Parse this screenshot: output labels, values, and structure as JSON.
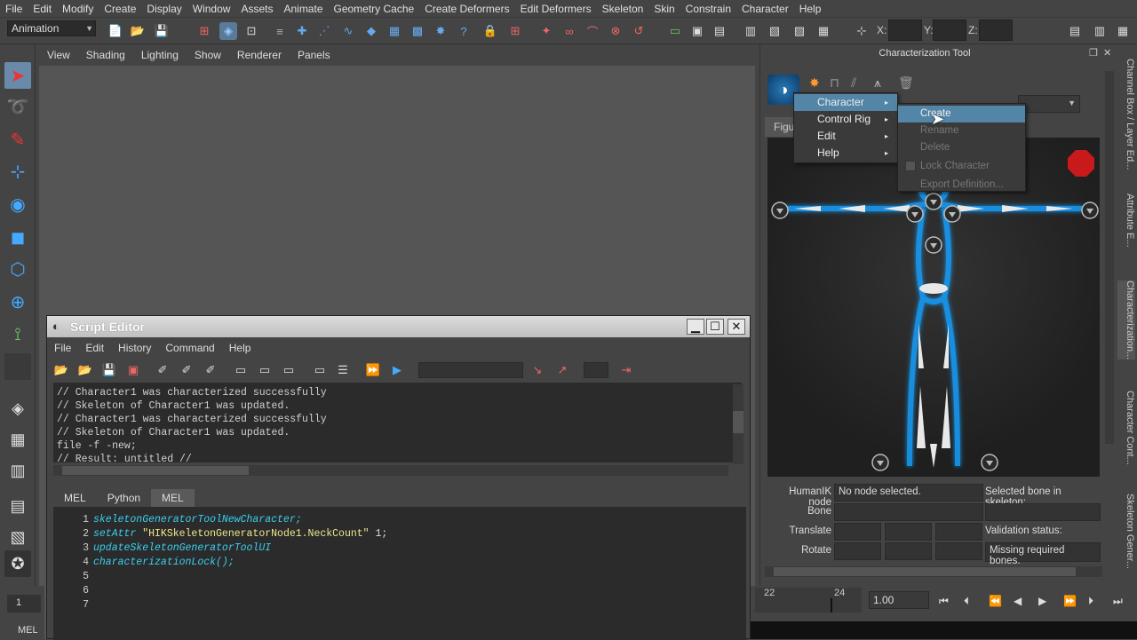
{
  "menubar": [
    "File",
    "Edit",
    "Modify",
    "Create",
    "Display",
    "Window",
    "Assets",
    "Animate",
    "Geometry Cache",
    "Create Deformers",
    "Edit Deformers",
    "Skeleton",
    "Skin",
    "Constrain",
    "Character",
    "Help"
  ],
  "status": {
    "mode": "Animation",
    "x_label": "X:",
    "y_label": "Y:",
    "z_label": "Z:"
  },
  "viewport": {
    "menu": [
      "View",
      "Shading",
      "Lighting",
      "Show",
      "Renderer",
      "Panels"
    ]
  },
  "script_editor": {
    "title": "Script Editor",
    "menu": [
      "File",
      "Edit",
      "History",
      "Command",
      "Help"
    ],
    "history": [
      "// Character1 was characterized successfully",
      "// Skeleton of Character1 was updated.",
      "// Character1 was characterized successfully",
      "// Skeleton of Character1 was updated.",
      "file -f -new;",
      "// Result: untitled //"
    ],
    "tabs": [
      "MEL",
      "Python",
      "MEL"
    ],
    "active_tab": 2,
    "line_numbers": [
      "1",
      "2",
      "3",
      "4",
      "5",
      "6",
      "7"
    ],
    "code": {
      "l1": "skeletonGeneratorToolNewCharacter;",
      "l2_cmd": "setAttr ",
      "l2_str": "\"HIKSkeletonGeneratorNode1.NeckCount\"",
      "l2_num": " 1;",
      "l3": "updateSkeletonGeneratorToolUI",
      "l4": "characterizationLock();"
    }
  },
  "characterization": {
    "title": "Characterization Tool",
    "figure_tab": "Figu",
    "humanik_label": "HumanIK node",
    "humanik_value": "No node selected.",
    "selected_bone_label": "Selected bone in skeleton:",
    "bone_label": "Bone",
    "translate_label": "Translate",
    "rotate_label": "Rotate",
    "validation_label": "Validation status:",
    "validation_value": "Missing required bones."
  },
  "context_menu": {
    "items": [
      {
        "label": "Character",
        "sub": "▸"
      },
      {
        "label": "Control Rig",
        "sub": "▸"
      },
      {
        "label": "Edit",
        "sub": "▸"
      },
      {
        "label": "Help",
        "sub": "▸"
      }
    ],
    "submenu": [
      "Create",
      "Rename",
      "Delete",
      "Lock Character",
      "Export Definition..."
    ]
  },
  "side_tabs": [
    "Channel Box / Layer Ed...",
    "Attribute E...",
    "Characterization...",
    "Character Cont...",
    "Skeleton Gener..."
  ],
  "timeline": {
    "tick_22": "22",
    "tick_24": "24",
    "speed": "1.00"
  },
  "bottom": {
    "frame": "1",
    "mel_label": "MEL"
  }
}
